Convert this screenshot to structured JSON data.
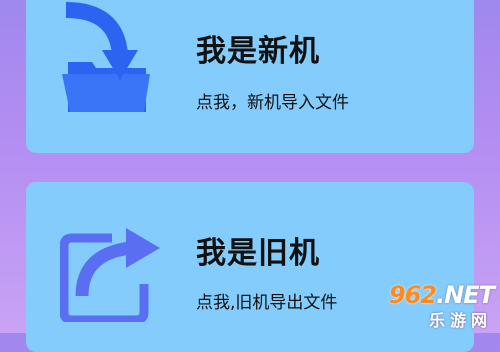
{
  "cards": [
    {
      "title": "我是新机",
      "subtitle": "点我，新机导入文件",
      "icon": "import-folder-icon"
    },
    {
      "title": "我是旧机",
      "subtitle": "点我,旧机导出文件",
      "icon": "export-share-icon"
    }
  ],
  "watermark": {
    "number": "962",
    "domain": ".NET",
    "text": "乐游网"
  },
  "colors": {
    "background_top": "#9f88ee",
    "background_bottom": "#c8a3f5",
    "card": "#83ccfb",
    "import_icon": "#2c63f0",
    "export_icon": "#5a6ef2",
    "watermark_accent": "#ff8a1e"
  }
}
